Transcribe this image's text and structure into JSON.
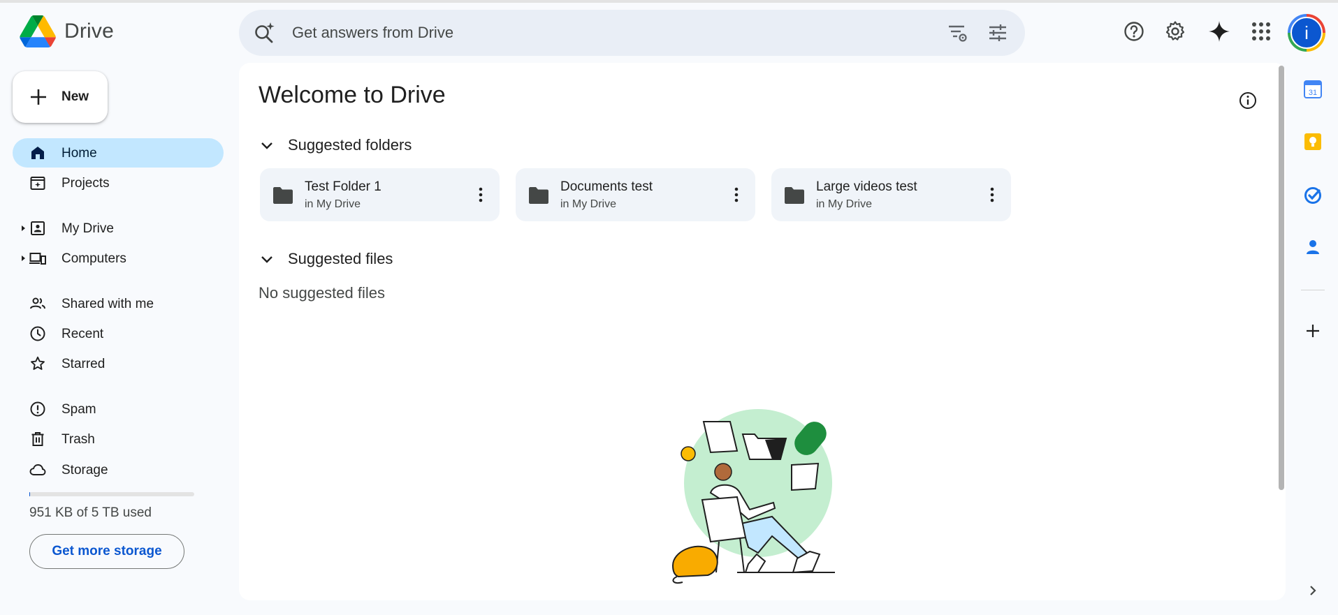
{
  "app": {
    "name": "Drive"
  },
  "search": {
    "placeholder": "Get answers from Drive"
  },
  "sidebar": {
    "new_label": "New",
    "items": [
      {
        "label": "Home",
        "icon": "home-icon",
        "active": true
      },
      {
        "label": "Projects",
        "icon": "projects-icon"
      },
      {
        "label": "My Drive",
        "icon": "my-drive-icon",
        "expandable": true
      },
      {
        "label": "Computers",
        "icon": "computers-icon",
        "expandable": true
      },
      {
        "label": "Shared with me",
        "icon": "shared-icon"
      },
      {
        "label": "Recent",
        "icon": "clock-icon"
      },
      {
        "label": "Starred",
        "icon": "star-icon"
      },
      {
        "label": "Spam",
        "icon": "spam-icon"
      },
      {
        "label": "Trash",
        "icon": "trash-icon"
      },
      {
        "label": "Storage",
        "icon": "cloud-icon"
      }
    ],
    "storage": {
      "used_text": "951 KB of 5 TB used",
      "used_fraction": 2e-07,
      "button_label": "Get more storage"
    }
  },
  "header": {
    "avatar_initial": "i"
  },
  "main": {
    "title": "Welcome to Drive",
    "suggested_folders": {
      "title": "Suggested folders",
      "folders": [
        {
          "name": "Test Folder 1",
          "location": "in My Drive"
        },
        {
          "name": "Documents test",
          "location": "in My Drive"
        },
        {
          "name": "Large videos test",
          "location": "in My Drive"
        }
      ]
    },
    "suggested_files": {
      "title": "Suggested files",
      "empty_text": "No suggested files"
    }
  },
  "colors": {
    "accent": "#0b57d0",
    "active_nav": "#c2e7ff",
    "background": "#f8fafd",
    "search_bg": "#e9eef6",
    "card_bg": "#f0f4f9"
  }
}
